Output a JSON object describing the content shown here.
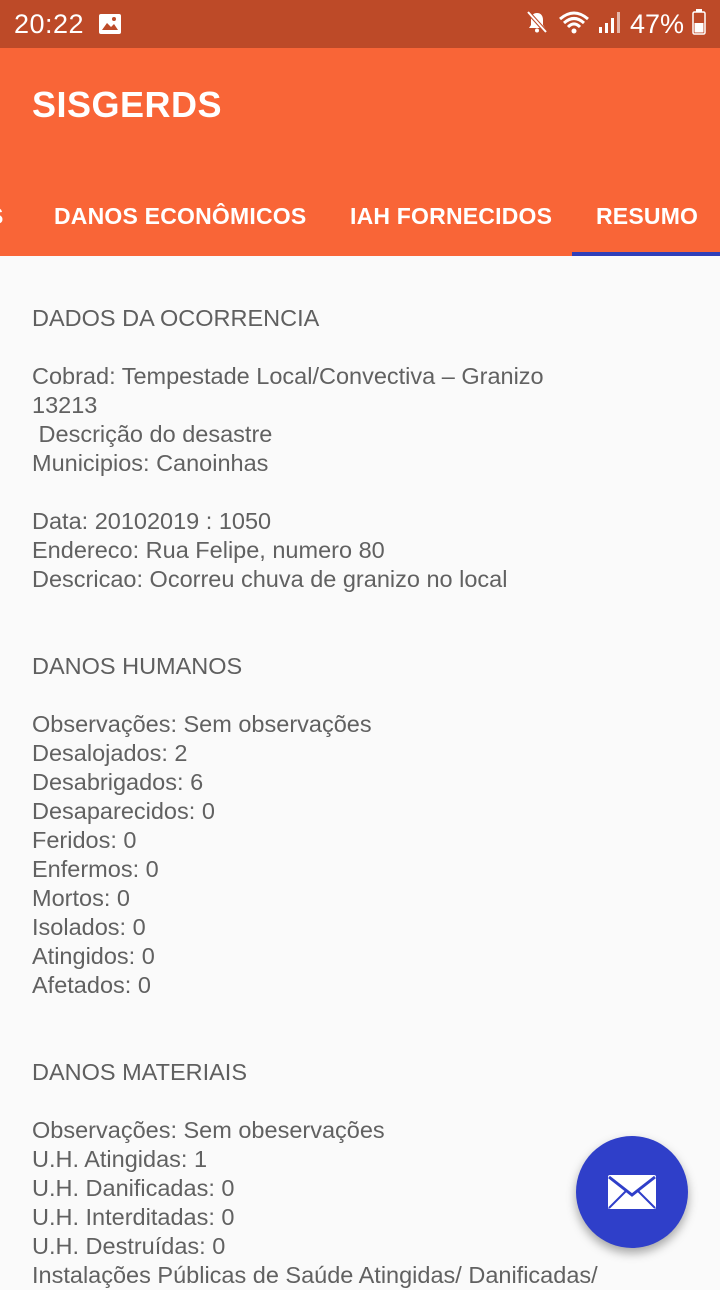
{
  "status_bar": {
    "time": "20:22",
    "battery": "47%",
    "icons": [
      "gallery-icon",
      "mute-icon",
      "wifi-icon",
      "signal-icon",
      "battery-icon"
    ]
  },
  "app_bar": {
    "title": "SISGERDS",
    "background_color": "#f96537"
  },
  "tabs": [
    {
      "label": "S"
    },
    {
      "label": "DANOS ECONÔMICOS"
    },
    {
      "label": "IAH FORNECIDOS"
    },
    {
      "label": "RESUMO",
      "selected": true
    }
  ],
  "content": {
    "ocorrencia": {
      "title": "DADOS DA OCORRENCIA",
      "cobrad": "Cobrad: Tempestade Local/Convectiva – Granizo",
      "code": "13213",
      "descricao_desastre": " Descrição do desastre",
      "municipios": "Municipios: Canoinhas",
      "data": "Data: 20102019 : 1050",
      "endereco": "Endereco: Rua Felipe, numero 80",
      "descricao": "Descricao: Ocorreu chuva de granizo no local"
    },
    "humanos": {
      "title": "DANOS HUMANOS",
      "lines": [
        "Observações: Sem observações",
        "Desalojados: 2",
        "Desabrigados: 6",
        "Desaparecidos: 0",
        "Feridos: 0",
        "Enfermos: 0",
        "Mortos: 0",
        "Isolados: 0",
        "Atingidos: 0",
        "Afetados: 0"
      ]
    },
    "materiais": {
      "title": "DANOS MATERIAIS",
      "lines": [
        "Observações: Sem obeservações",
        "U.H. Atingidas: 1",
        "U.H. Danificadas: 0",
        "U.H. Interditadas: 0",
        "U.H. Destruídas: 0",
        "Instalações Públicas de Saúde Atingidas/ Danificadas/"
      ]
    }
  },
  "fab": {
    "icon": "mail-icon",
    "color": "#2f3fc9"
  }
}
